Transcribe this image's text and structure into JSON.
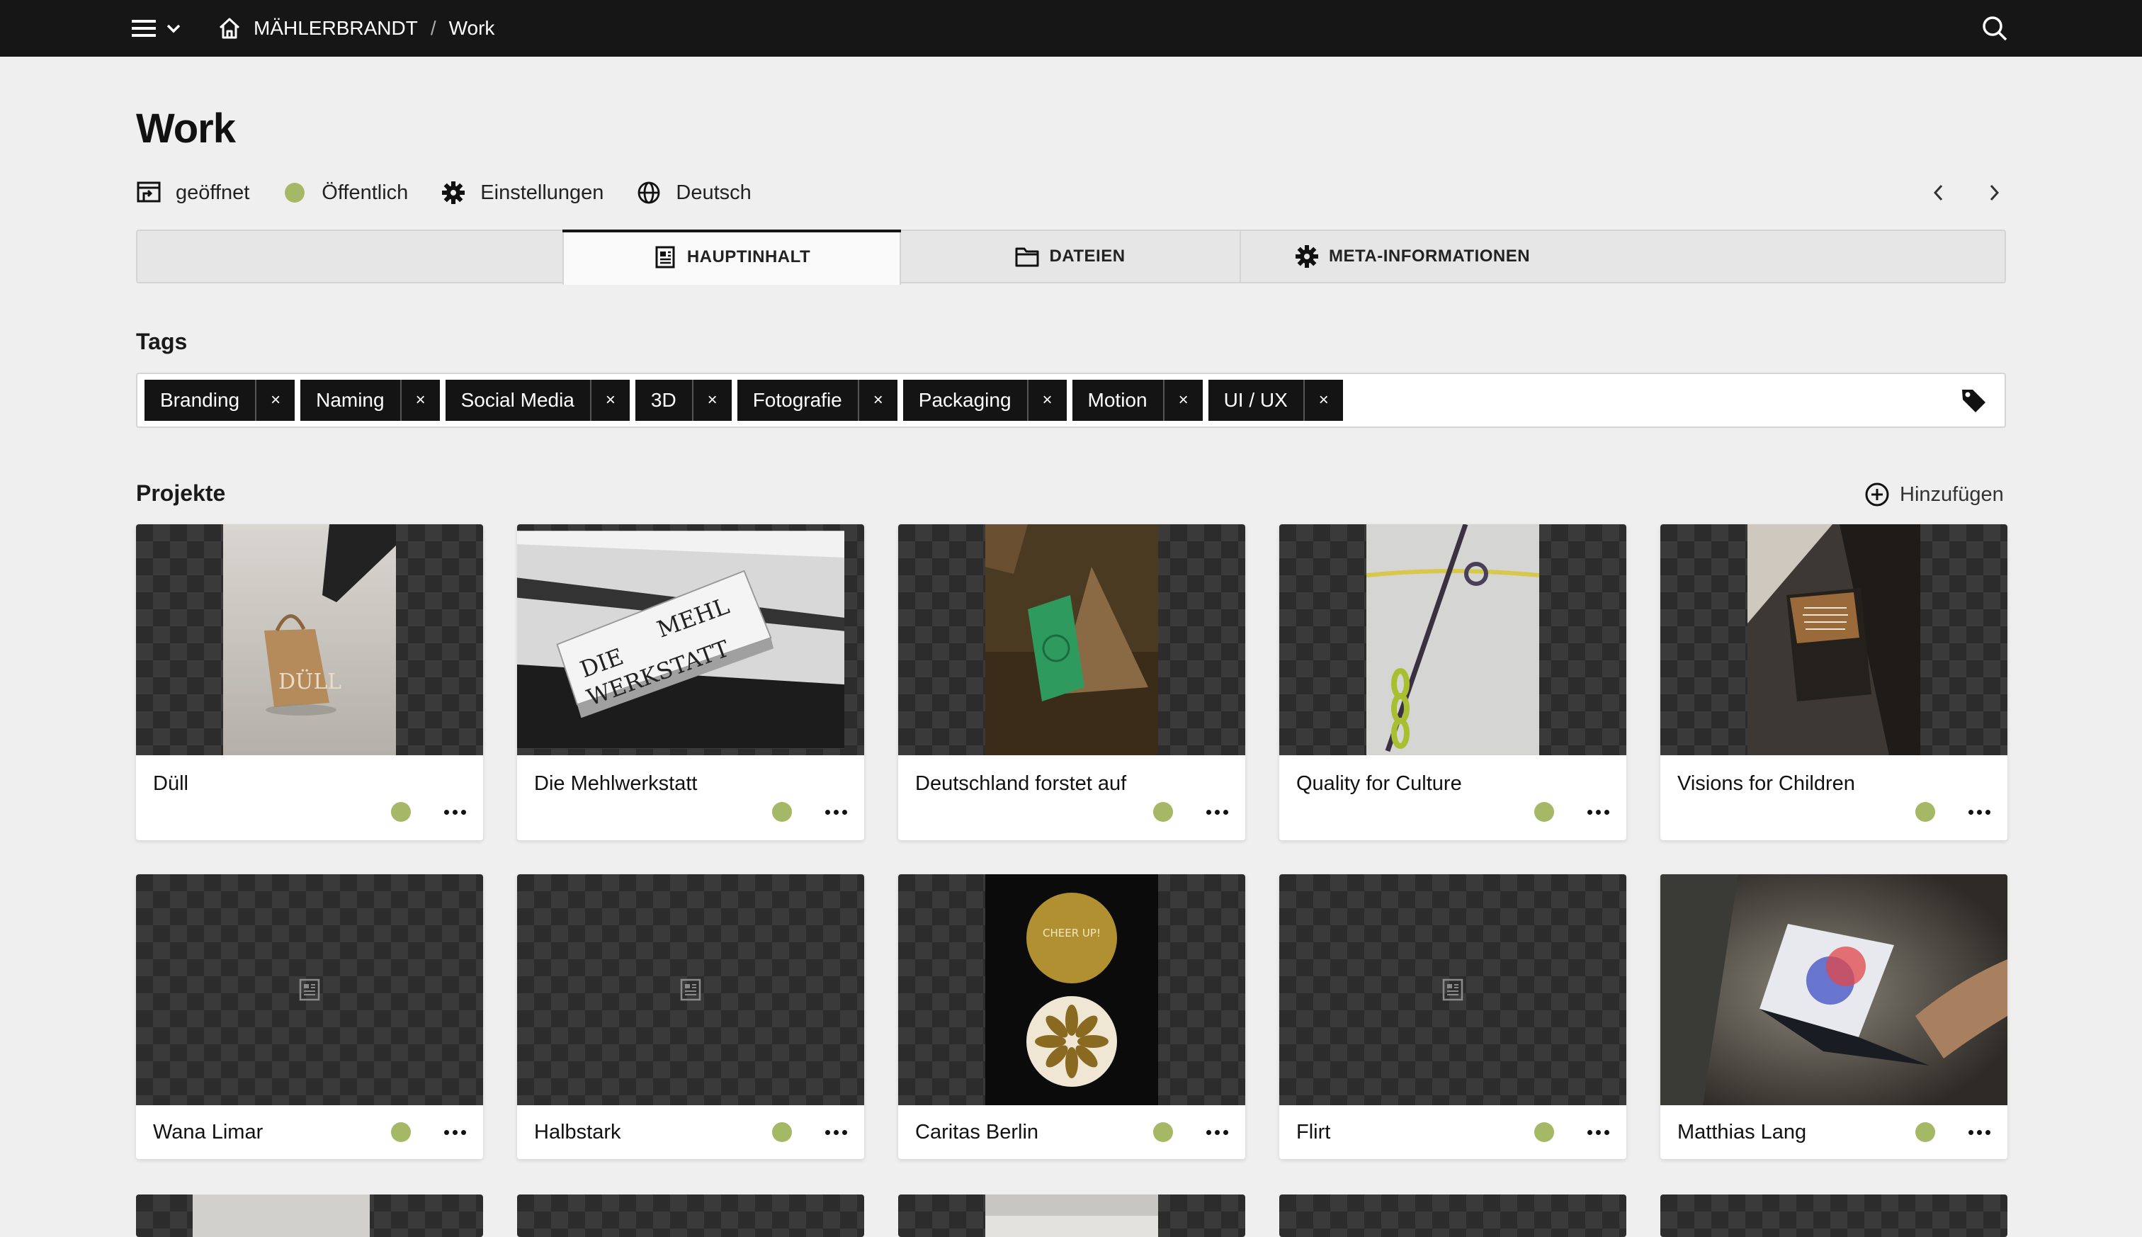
{
  "topbar": {
    "breadcrumb_root": "MÄHLERBRANDT",
    "breadcrumb_sep": "/",
    "breadcrumb_current": "Work"
  },
  "page": {
    "title": "Work",
    "status": "geöffnet",
    "visibility": "Öffentlich",
    "settings": "Einstellungen",
    "language": "Deutsch"
  },
  "tabs": {
    "main": "HAUPTINHALT",
    "files": "DATEIEN",
    "meta": "META-INFORMATIONEN"
  },
  "tags": {
    "label": "Tags",
    "remove_glyph": "×",
    "items": [
      "Branding",
      "Naming",
      "Social Media",
      "3D",
      "Fotografie",
      "Packaging",
      "Motion",
      "UI / UX"
    ]
  },
  "projects": {
    "label": "Projekte",
    "add_label": "Hinzufügen",
    "items": [
      {
        "title": "Düll"
      },
      {
        "title": "Die Mehlwerkstatt"
      },
      {
        "title": "Deutschland forstet auf"
      },
      {
        "title": "Quality for Culture"
      },
      {
        "title": "Visions for Children"
      },
      {
        "title": "Wana Limar"
      },
      {
        "title": "Halbstark"
      },
      {
        "title": "Caritas Berlin"
      },
      {
        "title": "Flirt"
      },
      {
        "title": "Matthias Lang"
      }
    ]
  },
  "image_text": {
    "duell_bag": "DÜLL",
    "mehl_sign_1": "DIE",
    "mehl_sign_2": "MEHL",
    "mehl_sign_3": "WERKSTATT",
    "cheer_badge": "CHEER UP!"
  },
  "colors": {
    "topbar": "#161616",
    "background": "#efefef",
    "status_green": "#a4b866",
    "tag_bg": "#141414"
  }
}
